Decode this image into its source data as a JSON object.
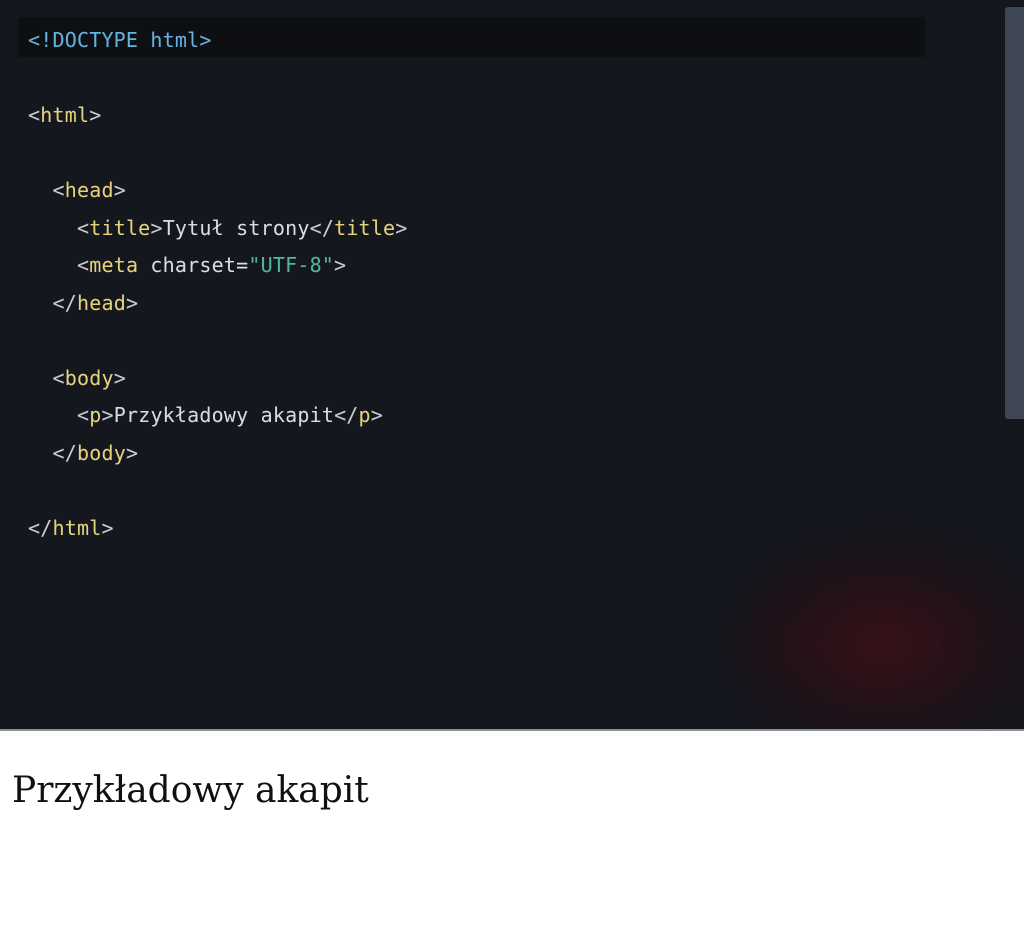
{
  "editor": {
    "language": "html",
    "highlighted_line_index": 0,
    "colors": {
      "background": "#15171e",
      "highlight_band": "#0e0f13",
      "doctype": "#63b3e0",
      "tag": "#e6d27a",
      "punctuation": "#c8ccd4",
      "attribute": "#d9dde4",
      "string": "#4db6a0",
      "text": "#d8dce3",
      "scrollbar_thumb": "#3f4656",
      "divider": "#8b9099"
    },
    "lines": [
      {
        "indent": 0,
        "tokens": [
          {
            "kind": "doctype",
            "text": "<!DOCTYPE html>"
          }
        ]
      },
      {
        "indent": 0,
        "tokens": []
      },
      {
        "indent": 0,
        "tokens": [
          {
            "kind": "punct",
            "text": "<"
          },
          {
            "kind": "tag",
            "text": "html"
          },
          {
            "kind": "punct",
            "text": ">"
          }
        ]
      },
      {
        "indent": 0,
        "tokens": []
      },
      {
        "indent": 1,
        "tokens": [
          {
            "kind": "punct",
            "text": "<"
          },
          {
            "kind": "tag",
            "text": "head"
          },
          {
            "kind": "punct",
            "text": ">"
          }
        ]
      },
      {
        "indent": 2,
        "tokens": [
          {
            "kind": "punct",
            "text": "<"
          },
          {
            "kind": "tag",
            "text": "title"
          },
          {
            "kind": "punct",
            "text": ">"
          },
          {
            "kind": "text",
            "text": "Tytuł strony"
          },
          {
            "kind": "punct",
            "text": "</"
          },
          {
            "kind": "tag",
            "text": "title"
          },
          {
            "kind": "punct",
            "text": ">"
          }
        ]
      },
      {
        "indent": 2,
        "tokens": [
          {
            "kind": "punct",
            "text": "<"
          },
          {
            "kind": "tag",
            "text": "meta"
          },
          {
            "kind": "attr",
            "text": " charset="
          },
          {
            "kind": "string",
            "text": "\"UTF-8\""
          },
          {
            "kind": "punct",
            "text": ">"
          }
        ]
      },
      {
        "indent": 1,
        "tokens": [
          {
            "kind": "punct",
            "text": "</"
          },
          {
            "kind": "tag",
            "text": "head"
          },
          {
            "kind": "punct",
            "text": ">"
          }
        ]
      },
      {
        "indent": 0,
        "tokens": []
      },
      {
        "indent": 1,
        "tokens": [
          {
            "kind": "punct",
            "text": "<"
          },
          {
            "kind": "tag",
            "text": "body"
          },
          {
            "kind": "punct",
            "text": ">"
          }
        ]
      },
      {
        "indent": 2,
        "tokens": [
          {
            "kind": "punct",
            "text": "<"
          },
          {
            "kind": "tag",
            "text": "p"
          },
          {
            "kind": "punct",
            "text": ">"
          },
          {
            "kind": "text",
            "text": "Przykładowy akapit"
          },
          {
            "kind": "punct",
            "text": "</"
          },
          {
            "kind": "tag",
            "text": "p"
          },
          {
            "kind": "punct",
            "text": ">"
          }
        ]
      },
      {
        "indent": 1,
        "tokens": [
          {
            "kind": "punct",
            "text": "</"
          },
          {
            "kind": "tag",
            "text": "body"
          },
          {
            "kind": "punct",
            "text": ">"
          }
        ]
      },
      {
        "indent": 0,
        "tokens": []
      },
      {
        "indent": 0,
        "tokens": [
          {
            "kind": "punct",
            "text": "</"
          },
          {
            "kind": "tag",
            "text": "html"
          },
          {
            "kind": "punct",
            "text": ">"
          }
        ]
      }
    ]
  },
  "output": {
    "paragraph": "Przykładowy akapit"
  }
}
